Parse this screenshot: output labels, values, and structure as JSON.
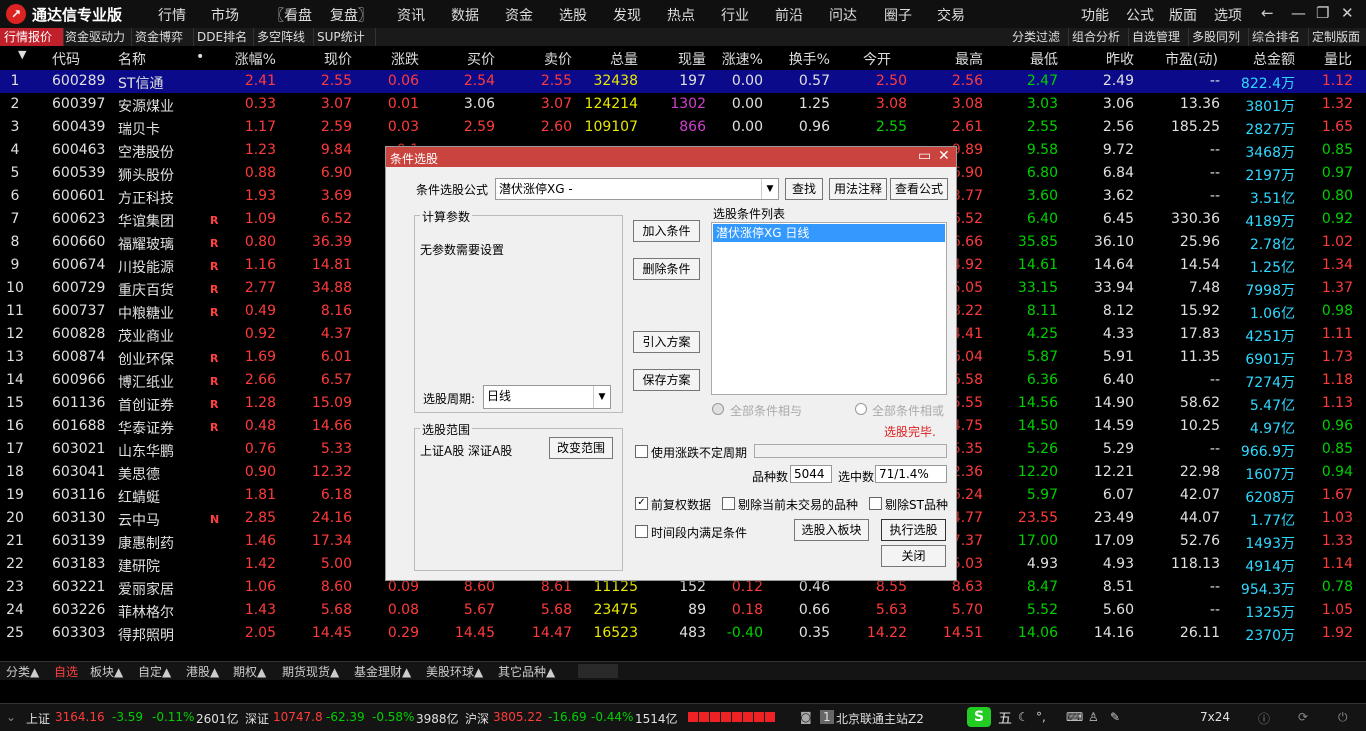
{
  "app": {
    "title": "通达信专业版",
    "menu": [
      "行情",
      "市场",
      "〖看盘",
      "复盘〗",
      "资讯",
      "数据",
      "资金",
      "选股",
      "发现",
      "热点",
      "行业",
      "前沿",
      "问达",
      "圈子",
      "交易"
    ],
    "right_menu": [
      "功能",
      "公式",
      "版面",
      "选项"
    ]
  },
  "tabs_left": [
    "行情报价",
    "资金驱动力",
    "资金博弈",
    "DDE排名",
    "多空阵线",
    "SUP统计"
  ],
  "tabs_right": [
    "分类过滤",
    "组合分析",
    "自选管理",
    "多股同列",
    "综合排名",
    "定制版面"
  ],
  "table": {
    "headers": [
      "代码",
      "名称",
      "•",
      "涨幅%",
      "现价",
      "涨跌",
      "买价",
      "卖价",
      "总量",
      "现量",
      "涨速%",
      "换手%",
      "今开",
      "最高",
      "最低",
      "昨收",
      "市盈(动)",
      "总金额",
      "量比"
    ],
    "rows": [
      {
        "n": "1",
        "code": "600289",
        "name": "ST信通",
        "flag": "",
        "chg": "2.41",
        "price": "2.55",
        "diff": "0.06",
        "bid": "2.54",
        "ask": "2.55",
        "vol": "32438",
        "cur": "197",
        "speed": "0.00",
        "turn": "0.57",
        "open": "2.50",
        "high": "2.56",
        "low": "2.47",
        "prev": "2.49",
        "pe": "--",
        "amt": "822.4万",
        "ratio": "1.12",
        "curc": "white",
        "openc": "red",
        "lowc": "green",
        "selected": true
      },
      {
        "n": "2",
        "code": "600397",
        "name": "安源煤业",
        "flag": "",
        "chg": "0.33",
        "price": "3.07",
        "diff": "0.01",
        "bid": "3.06",
        "ask": "3.07",
        "vol": "124214",
        "cur": "1302",
        "speed": "0.00",
        "turn": "1.25",
        "open": "3.08",
        "high": "3.08",
        "low": "3.03",
        "prev": "3.06",
        "pe": "13.36",
        "amt": "3801万",
        "ratio": "1.32",
        "curc": "magenta",
        "openc": "red",
        "lowc": "green",
        "bidc": "white"
      },
      {
        "n": "3",
        "code": "600439",
        "name": "瑞贝卡",
        "flag": "",
        "chg": "1.17",
        "price": "2.59",
        "diff": "0.03",
        "bid": "2.59",
        "ask": "2.60",
        "vol": "109107",
        "cur": "866",
        "speed": "0.00",
        "turn": "0.96",
        "open": "2.55",
        "high": "2.61",
        "low": "2.55",
        "prev": "2.56",
        "pe": "185.25",
        "amt": "2827万",
        "ratio": "1.65",
        "curc": "magenta",
        "openc": "green",
        "lowc": "green"
      },
      {
        "n": "4",
        "code": "600463",
        "name": "空港股份",
        "flag": "",
        "chg": "1.23",
        "price": "9.84",
        "diff": "0.1",
        "high": "9.89",
        "low": "9.58",
        "prev": "9.72",
        "pe": "--",
        "amt": "3468万",
        "ratio": "0.85",
        "lowc": "green",
        "ratioc": "green"
      },
      {
        "n": "5",
        "code": "600539",
        "name": "狮头股份",
        "flag": "",
        "chg": "0.88",
        "price": "6.90",
        "diff": "0.0",
        "high": "6.90",
        "low": "6.80",
        "prev": "6.84",
        "pe": "--",
        "amt": "2197万",
        "ratio": "0.97",
        "lowc": "green",
        "ratioc": "green"
      },
      {
        "n": "6",
        "code": "600601",
        "name": "方正科技",
        "flag": "",
        "chg": "1.93",
        "price": "3.69",
        "diff": "0.0",
        "high": "3.77",
        "low": "3.60",
        "prev": "3.62",
        "pe": "--",
        "amt": "3.51亿",
        "ratio": "0.80",
        "lowc": "green",
        "ratioc": "green"
      },
      {
        "n": "7",
        "code": "600623",
        "name": "华谊集团",
        "flag": "R",
        "chg": "1.09",
        "price": "6.52",
        "diff": "0.0",
        "high": "6.52",
        "low": "6.40",
        "prev": "6.45",
        "pe": "330.36",
        "amt": "4189万",
        "ratio": "0.92",
        "lowc": "green",
        "ratioc": "green"
      },
      {
        "n": "8",
        "code": "600660",
        "name": "福耀玻璃",
        "flag": "R",
        "chg": "0.80",
        "price": "36.39",
        "diff": "0.2",
        "high": "36.66",
        "low": "35.85",
        "prev": "36.10",
        "pe": "25.96",
        "amt": "2.78亿",
        "ratio": "1.02",
        "lowc": "green"
      },
      {
        "n": "9",
        "code": "600674",
        "name": "川投能源",
        "flag": "R",
        "chg": "1.16",
        "price": "14.81",
        "diff": "0.1",
        "high": "14.92",
        "low": "14.61",
        "prev": "14.64",
        "pe": "14.54",
        "amt": "1.25亿",
        "ratio": "1.34",
        "lowc": "green"
      },
      {
        "n": "10",
        "code": "600729",
        "name": "重庆百货",
        "flag": "R",
        "chg": "2.77",
        "price": "34.88",
        "diff": "0.9",
        "high": "35.05",
        "low": "33.15",
        "prev": "33.94",
        "pe": "7.48",
        "amt": "7998万",
        "ratio": "1.37",
        "lowc": "green"
      },
      {
        "n": "11",
        "code": "600737",
        "name": "中粮糖业",
        "flag": "R",
        "chg": "0.49",
        "price": "8.16",
        "diff": "0.0",
        "high": "8.22",
        "low": "8.11",
        "prev": "8.12",
        "pe": "15.92",
        "amt": "1.06亿",
        "ratio": "0.98",
        "lowc": "green",
        "ratioc": "green"
      },
      {
        "n": "12",
        "code": "600828",
        "name": "茂业商业",
        "flag": "",
        "chg": "0.92",
        "price": "4.37",
        "diff": "0.0",
        "high": "4.41",
        "low": "4.25",
        "prev": "4.33",
        "pe": "17.83",
        "amt": "4251万",
        "ratio": "1.11",
        "lowc": "green"
      },
      {
        "n": "13",
        "code": "600874",
        "name": "创业环保",
        "flag": "R",
        "chg": "1.69",
        "price": "6.01",
        "diff": "0.1",
        "high": "6.04",
        "low": "5.87",
        "prev": "5.91",
        "pe": "11.35",
        "amt": "6901万",
        "ratio": "1.73",
        "lowc": "green"
      },
      {
        "n": "14",
        "code": "600966",
        "name": "博汇纸业",
        "flag": "R",
        "chg": "2.66",
        "price": "6.57",
        "diff": "0.1",
        "high": "6.58",
        "low": "6.36",
        "prev": "6.40",
        "pe": "--",
        "amt": "7274万",
        "ratio": "1.18",
        "lowc": "green"
      },
      {
        "n": "15",
        "code": "601136",
        "name": "首创证券",
        "flag": "R",
        "chg": "1.28",
        "price": "15.09",
        "diff": "0.1",
        "high": "15.55",
        "low": "14.56",
        "prev": "14.90",
        "pe": "58.62",
        "amt": "5.47亿",
        "ratio": "1.13",
        "lowc": "green"
      },
      {
        "n": "16",
        "code": "601688",
        "name": "华泰证券",
        "flag": "R",
        "chg": "0.48",
        "price": "14.66",
        "diff": "0.0",
        "high": "14.75",
        "low": "14.50",
        "prev": "14.59",
        "pe": "10.25",
        "amt": "4.97亿",
        "ratio": "0.96",
        "lowc": "green",
        "ratioc": "green"
      },
      {
        "n": "17",
        "code": "603021",
        "name": "山东华鹏",
        "flag": "",
        "chg": "0.76",
        "price": "5.33",
        "diff": "0.0",
        "high": "5.35",
        "low": "5.26",
        "prev": "5.29",
        "pe": "--",
        "amt": "966.9万",
        "ratio": "0.85",
        "lowc": "green",
        "ratioc": "green"
      },
      {
        "n": "18",
        "code": "603041",
        "name": "美思德",
        "flag": "",
        "chg": "0.90",
        "price": "12.32",
        "diff": "0.1",
        "high": "12.36",
        "low": "12.20",
        "prev": "12.21",
        "pe": "22.98",
        "amt": "1607万",
        "ratio": "0.94",
        "lowc": "green",
        "ratioc": "green"
      },
      {
        "n": "19",
        "code": "603116",
        "name": "红蜻蜓",
        "flag": "",
        "chg": "1.81",
        "price": "6.18",
        "diff": "0.1",
        "high": "6.24",
        "low": "5.97",
        "prev": "6.07",
        "pe": "42.07",
        "amt": "6208万",
        "ratio": "1.67",
        "lowc": "green"
      },
      {
        "n": "20",
        "code": "603130",
        "name": "云中马",
        "flag": "N",
        "chg": "2.85",
        "price": "24.16",
        "diff": "0.6",
        "high": "24.77",
        "low": "23.55",
        "prev": "23.49",
        "pe": "44.07",
        "amt": "1.77亿",
        "ratio": "1.03",
        "lowc": "red"
      },
      {
        "n": "21",
        "code": "603139",
        "name": "康惠制药",
        "flag": "",
        "chg": "1.46",
        "price": "17.34",
        "diff": "0.2",
        "high": "17.37",
        "low": "17.00",
        "prev": "17.09",
        "pe": "52.76",
        "amt": "1493万",
        "ratio": "1.33",
        "lowc": "green"
      },
      {
        "n": "22",
        "code": "603183",
        "name": "建研院",
        "flag": "",
        "chg": "1.42",
        "price": "5.00",
        "diff": "0.0",
        "high": "5.03",
        "low": "4.93",
        "prev": "4.93",
        "pe": "118.13",
        "amt": "4914万",
        "ratio": "1.14",
        "lowc": "white"
      },
      {
        "n": "23",
        "code": "603221",
        "name": "爱丽家居",
        "flag": "",
        "chg": "1.06",
        "price": "8.60",
        "diff": "0.09",
        "bid": "8.60",
        "ask": "8.61",
        "vol": "11125",
        "cur": "152",
        "speed": "0.12",
        "turn": "0.46",
        "open": "8.55",
        "high": "8.63",
        "low": "8.47",
        "prev": "8.51",
        "pe": "--",
        "amt": "954.3万",
        "ratio": "0.78",
        "curc": "white",
        "openc": "red",
        "lowc": "green",
        "ratioc": "green",
        "speedc": "red"
      },
      {
        "n": "24",
        "code": "603226",
        "name": "菲林格尔",
        "flag": "",
        "chg": "1.43",
        "price": "5.68",
        "diff": "0.08",
        "bid": "5.67",
        "ask": "5.68",
        "vol": "23475",
        "cur": "89",
        "speed": "0.18",
        "turn": "0.66",
        "open": "5.63",
        "high": "5.70",
        "low": "5.52",
        "prev": "5.60",
        "pe": "--",
        "amt": "1325万",
        "ratio": "1.05",
        "curc": "white",
        "openc": "red",
        "lowc": "green",
        "speedc": "red"
      },
      {
        "n": "25",
        "code": "603303",
        "name": "得邦照明",
        "flag": "",
        "chg": "2.05",
        "price": "14.45",
        "diff": "0.29",
        "bid": "14.45",
        "ask": "14.47",
        "vol": "16523",
        "cur": "483",
        "speed": "-0.40",
        "turn": "0.35",
        "open": "14.22",
        "high": "14.51",
        "low": "14.06",
        "prev": "14.16",
        "pe": "26.11",
        "amt": "2370万",
        "ratio": "1.92",
        "curc": "white",
        "openc": "red",
        "lowc": "green",
        "speedc": "green"
      }
    ]
  },
  "catbar": [
    "分类▲",
    "自选",
    "板块▲",
    "自定▲",
    "港股▲",
    "期权▲",
    "期货现货▲",
    "基金理财▲",
    "美股环球▲",
    "其它品种▲"
  ],
  "status": {
    "sh_label": "上证",
    "sh_val": "3164.16",
    "sh_chg": "-3.59",
    "sh_pct": "-0.11%",
    "sh_amt": "2601亿",
    "sz_label": "深证",
    "sz_val": "10747.8",
    "sz_chg": "-62.39",
    "sz_pct": "-0.58%",
    "sz_amt": "3988亿",
    "hs_label": "沪深",
    "hs_val": "3805.22",
    "hs_chg": "-16.69",
    "hs_pct": "-0.44%",
    "hs_amt": "1514亿",
    "server": "北京联通主站Z2",
    "server_no": "1",
    "ime": "五",
    "clock": "7x24"
  },
  "dialog": {
    "title": "条件选股",
    "formula_label": "条件选股公式",
    "formula_value": "潜伏涨停XG   -",
    "btn_find": "查找",
    "btn_usage": "用法注释",
    "btn_view": "查看公式",
    "params_group": "计算参数",
    "params_text": "无参数需要设置",
    "period_label": "选股周期:",
    "period_value": "日线",
    "btn_add": "加入条件",
    "btn_delete": "删除条件",
    "btn_import": "引入方案",
    "btn_save": "保存方案",
    "list_label": "选股条件列表",
    "list_item": "潜伏涨停XG  日线",
    "radio_and": "全部条件相与",
    "radio_or": "全部条件相或",
    "done_text": "选股完毕.",
    "range_group": "选股范围",
    "range_text": "上证A股 深证A股",
    "btn_range": "改变范围",
    "chk_period": "使用涨跌不定周期",
    "count_label": "品种数",
    "count_value": "5044",
    "hit_label": "选中数",
    "hit_value": "71/1.4%",
    "chk_fq": "前复权数据",
    "chk_untraded": "剔除当前未交易的品种",
    "chk_st": "剔除ST品种",
    "chk_time": "时间段内满足条件",
    "btn_to_block": "选股入板块",
    "btn_exec": "执行选股",
    "btn_close": "关闭"
  }
}
